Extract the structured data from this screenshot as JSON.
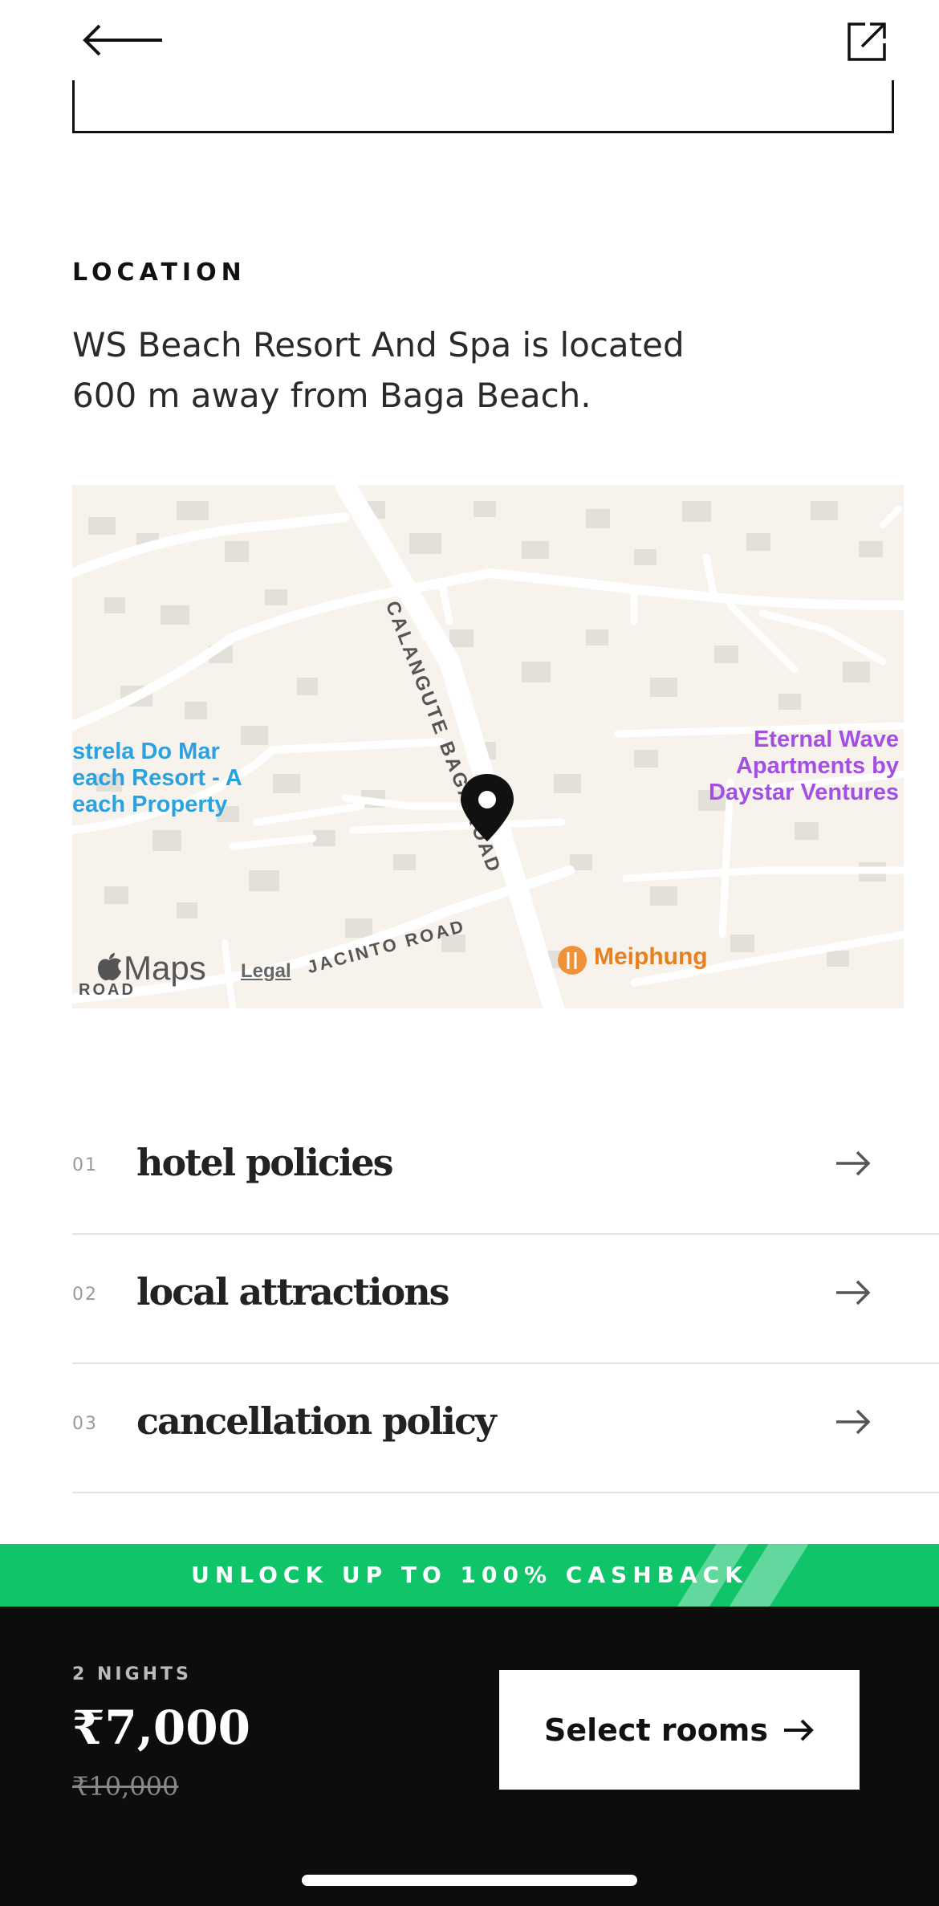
{
  "header": {
    "back_icon": "arrow-left-icon",
    "share_icon": "external-link-icon"
  },
  "location": {
    "label": "LOCATION",
    "description": "WS Beach Resort And Spa is located 600 m away from Baga Beach."
  },
  "map": {
    "provider_logo": "Maps",
    "legal_label": "Legal",
    "pois": {
      "left": "strela Do Mar\neach Resort - A\neach Property",
      "right": "Eternal Wave Apartments by Daystar Ventures",
      "restaurant": "Meiphung"
    },
    "roads": {
      "main": "CALANGUTE BAGA ROAD",
      "secondary": "JACINTO ROAD",
      "corner": "ROAD"
    },
    "colors": {
      "land": "#f7f3ec",
      "block": "#e3e0da",
      "road": "#ffffff",
      "poi_blue": "#2aa2e0",
      "poi_purple": "#a34fe6",
      "poi_orange": "#e8801f"
    }
  },
  "sections": [
    {
      "number": "01",
      "title": "hotel policies"
    },
    {
      "number": "02",
      "title": "local attractions"
    },
    {
      "number": "03",
      "title": "cancellation policy"
    }
  ],
  "cashback": {
    "text": "UNLOCK UP TO 100% CASHBACK",
    "color": "#10c46a"
  },
  "booking": {
    "nights_label": "2 NIGHTS",
    "price": "₹7,000",
    "original_price": "₹10,000",
    "cta_label": "Select rooms",
    "cta_icon": "arrow-right-icon"
  }
}
